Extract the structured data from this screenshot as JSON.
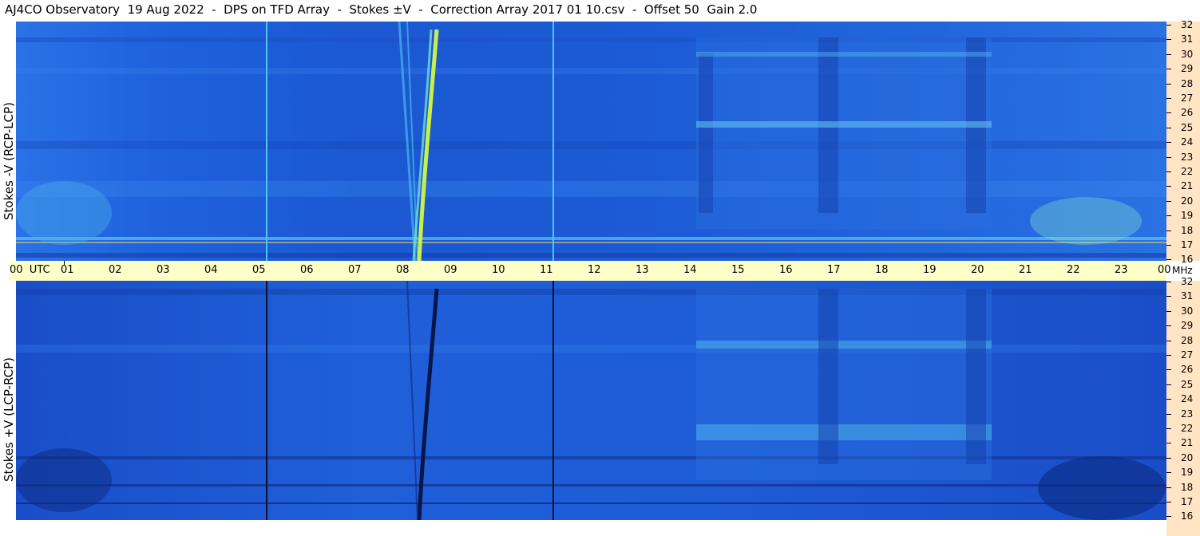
{
  "title": "AJ4CO Observatory  19 Aug 2022  -  DPS on TFD Array  -  Stokes ±V  -  Correction Array 2017 01 10.csv  -  Offset 50  Gain 2.0",
  "top_panel": {
    "ylabel": "Stokes -V (RCP-LCP)"
  },
  "bottom_panel": {
    "ylabel": "Stokes +V (LCP-RCP)"
  },
  "utc_axis": {
    "start_label": "00  UTC",
    "labels": [
      "01",
      "02",
      "03",
      "04",
      "05",
      "06",
      "07",
      "08",
      "09",
      "10",
      "11",
      "12",
      "13",
      "14",
      "15",
      "16",
      "17",
      "18",
      "19",
      "20",
      "21",
      "22",
      "23"
    ],
    "end_label": "00"
  },
  "freq_axis": {
    "unit": "MHz",
    "labels": [
      "32",
      "31",
      "30",
      "29",
      "28",
      "27",
      "26",
      "25",
      "24",
      "23",
      "22",
      "21",
      "20",
      "19",
      "18",
      "17",
      "16"
    ]
  },
  "colors": {
    "background": "#1f5fd8",
    "utc_bar": "#ffffc8",
    "freq_column": "#ffe5c4",
    "burst_top": "#c8f04a",
    "burst_bottom": "#06154a"
  }
}
